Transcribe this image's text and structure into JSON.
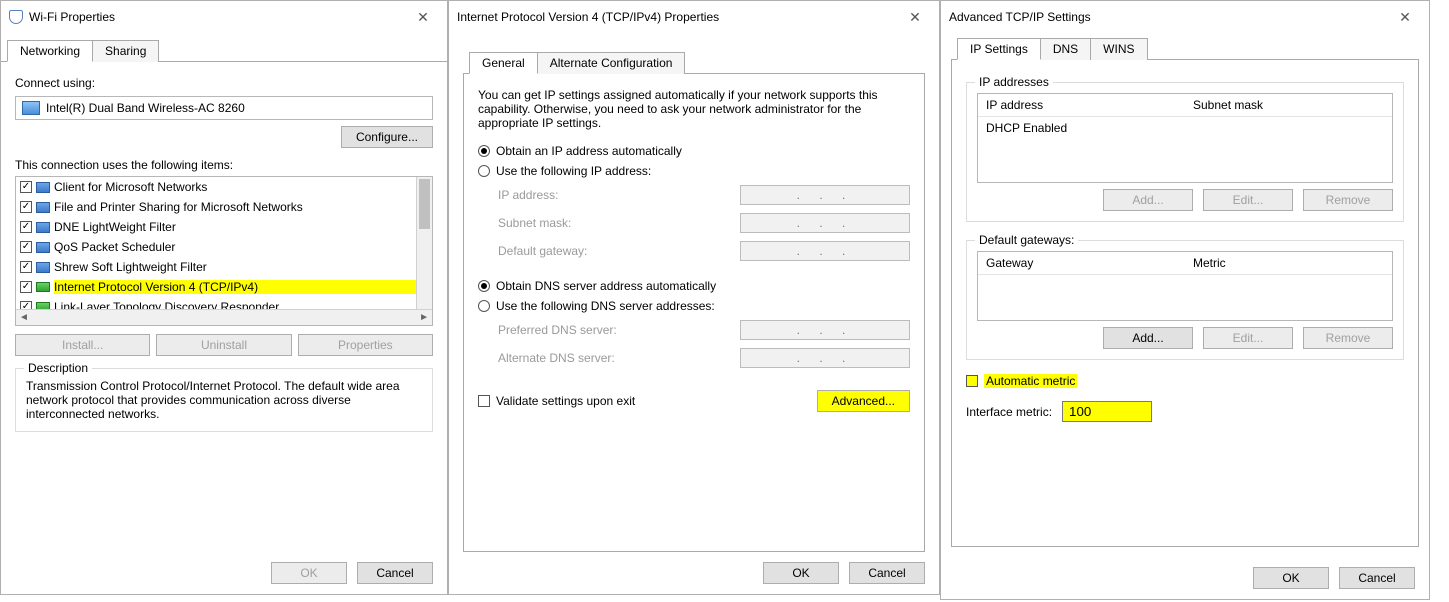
{
  "dlg1": {
    "title": "Wi-Fi Properties",
    "tabs": [
      "Networking",
      "Sharing"
    ],
    "connect_using_label": "Connect using:",
    "adapter": "Intel(R) Dual Band Wireless-AC 8260",
    "configure_btn": "Configure...",
    "items_label": "This connection uses the following items:",
    "items": [
      "Client for Microsoft Networks",
      "File and Printer Sharing for Microsoft Networks",
      "DNE LightWeight Filter",
      "QoS Packet Scheduler",
      "Shrew Soft Lightweight Filter",
      "Internet Protocol Version 4 (TCP/IPv4)",
      "Link-Layer Topology Discovery Responder"
    ],
    "btns": {
      "install": "Install...",
      "uninstall": "Uninstall",
      "properties": "Properties"
    },
    "description_label": "Description",
    "description": "Transmission Control Protocol/Internet Protocol. The default wide area network protocol that provides communication across diverse interconnected networks.",
    "ok": "OK",
    "cancel": "Cancel"
  },
  "dlg2": {
    "title": "Internet Protocol Version 4 (TCP/IPv4) Properties",
    "tabs": [
      "General",
      "Alternate Configuration"
    ],
    "intro": "You can get IP settings assigned automatically if your network supports this capability. Otherwise, you need to ask your network administrator for the appropriate IP settings.",
    "r_ip_auto": "Obtain an IP address automatically",
    "r_ip_manual": "Use the following IP address:",
    "ip_label": "IP address:",
    "subnet_label": "Subnet mask:",
    "gateway_label": "Default gateway:",
    "r_dns_auto": "Obtain DNS server address automatically",
    "r_dns_manual": "Use the following DNS server addresses:",
    "dns1_label": "Preferred DNS server:",
    "dns2_label": "Alternate DNS server:",
    "validate": "Validate settings upon exit",
    "advanced": "Advanced...",
    "ok": "OK",
    "cancel": "Cancel",
    "dots": ".   .   ."
  },
  "dlg3": {
    "title": "Advanced TCP/IP Settings",
    "tabs": [
      "IP Settings",
      "DNS",
      "WINS"
    ],
    "ip_group": "IP addresses",
    "ip_col1": "IP address",
    "ip_col2": "Subnet mask",
    "dhcp_row": "DHCP Enabled",
    "gw_group": "Default gateways:",
    "gw_col1": "Gateway",
    "gw_col2": "Metric",
    "add": "Add...",
    "edit": "Edit...",
    "remove": "Remove",
    "auto_metric": "Automatic metric",
    "interface_metric_label": "Interface metric:",
    "interface_metric_value": "100",
    "ok": "OK",
    "cancel": "Cancel"
  }
}
